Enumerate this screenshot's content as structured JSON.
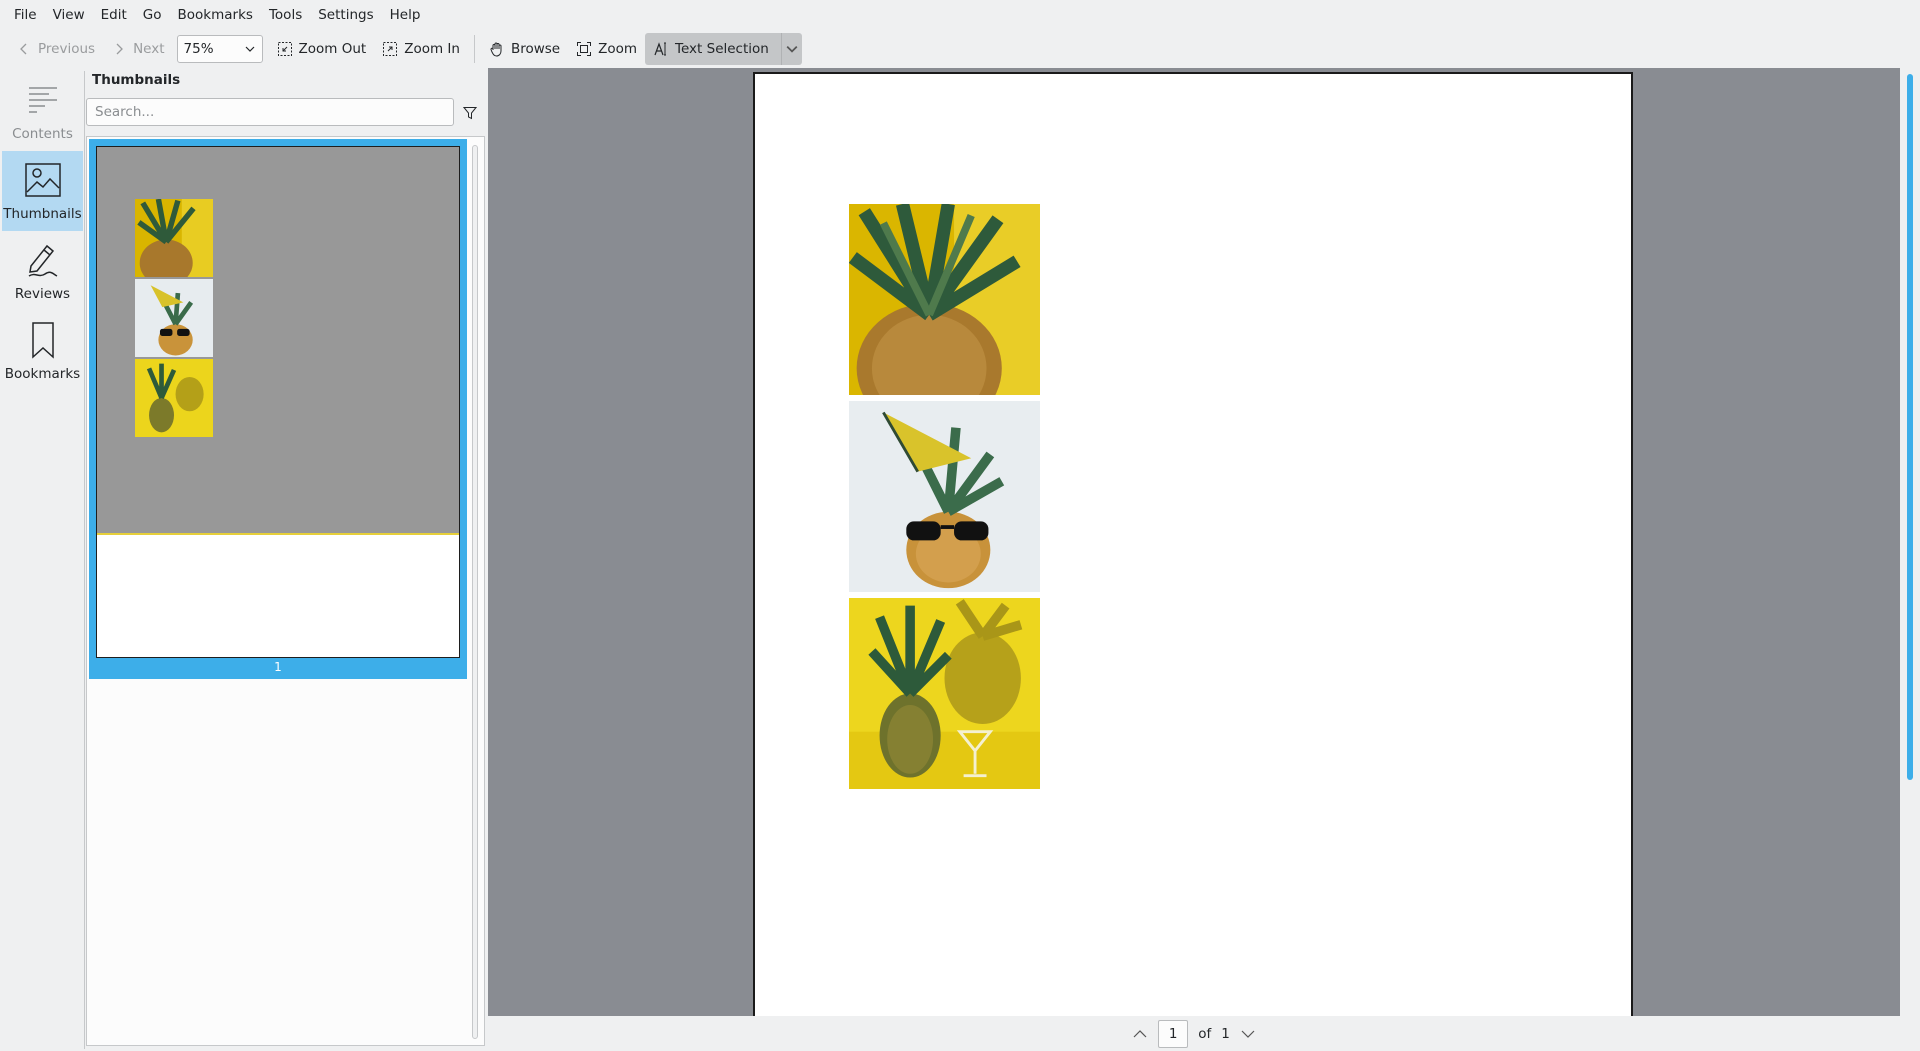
{
  "menu": [
    "File",
    "View",
    "Edit",
    "Go",
    "Bookmarks",
    "Tools",
    "Settings",
    "Help"
  ],
  "toolbar": {
    "previous": "Previous",
    "next": "Next",
    "zoom_value": "75%",
    "zoom_out": "Zoom Out",
    "zoom_in": "Zoom In",
    "browse": "Browse",
    "zoom": "Zoom",
    "text_selection": "Text Selection"
  },
  "sidebar": {
    "contents": "Contents",
    "thumbnails": "Thumbnails",
    "reviews": "Reviews",
    "bookmarks": "Bookmarks"
  },
  "thumbnails_panel": {
    "title": "Thumbnails",
    "search_placeholder": "Search...",
    "page_number": "1"
  },
  "bottom_nav": {
    "current_page": "1",
    "of_label": "of",
    "total_pages": "1"
  },
  "colors": {
    "accent": "#3daee9",
    "canvas": "#898c92",
    "pineapple_yellow": "#e3c514"
  }
}
